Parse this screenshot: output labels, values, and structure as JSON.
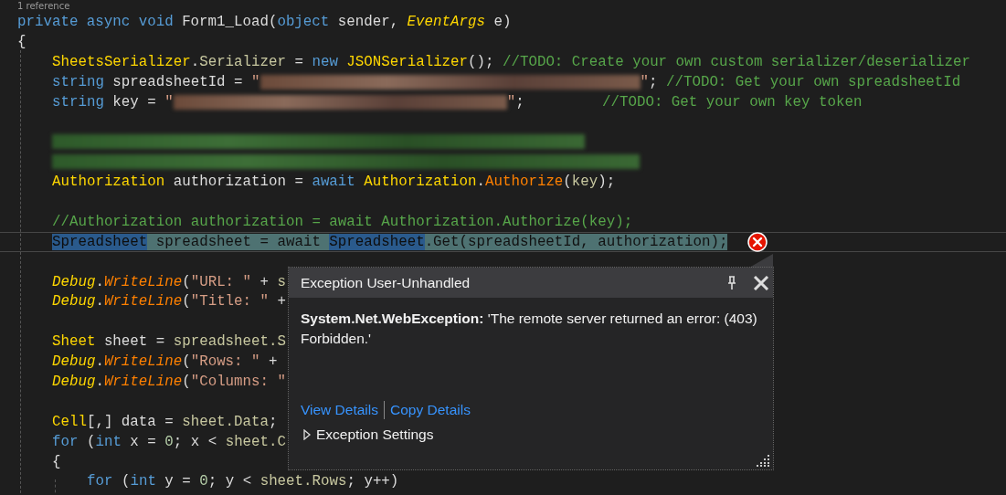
{
  "codelens": "1 reference",
  "lines": [
    {
      "kind": "code",
      "tokens": [
        {
          "kind": "keyword",
          "text": "private async void "
        },
        {
          "kind": "plain",
          "text": "Form1_Load("
        },
        {
          "kind": "keyword",
          "text": "object "
        },
        {
          "kind": "plain",
          "text": "sender, "
        },
        {
          "kind": "static-type",
          "text": "EventArgs"
        },
        {
          "kind": "plain",
          "text": " e)"
        }
      ]
    },
    {
      "kind": "code",
      "tokens": [
        {
          "kind": "plain",
          "text": "{"
        }
      ],
      "children": [
        {
          "kind": "code",
          "tokens": [
            {
              "kind": "type",
              "text": "SheetsSerializer"
            },
            {
              "kind": "plain",
              "text": "."
            },
            {
              "kind": "member",
              "text": "Serializer"
            },
            {
              "kind": "plain",
              "text": " = "
            },
            {
              "kind": "keyword",
              "text": "new "
            },
            {
              "kind": "type",
              "text": "JSONSerializer"
            },
            {
              "kind": "plain",
              "text": "(); "
            },
            {
              "kind": "comment",
              "text": "//TODO: Create your own custom serializer/deserializer"
            }
          ]
        },
        {
          "kind": "code",
          "tokens": [
            {
              "kind": "keyword",
              "text": "string "
            },
            {
              "kind": "plain",
              "text": "spreadsheetId = "
            },
            {
              "kind": "string",
              "text": "\""
            },
            {
              "kind": "redacted"
            },
            {
              "kind": "string",
              "text": "\""
            },
            {
              "kind": "plain",
              "text": "; "
            },
            {
              "kind": "comment",
              "text": "//TODO: Get your own spreadsheetId"
            }
          ]
        },
        {
          "kind": "code",
          "tokens": [
            {
              "kind": "keyword",
              "text": "string "
            },
            {
              "kind": "plain",
              "text": "key = "
            },
            {
              "kind": "string",
              "text": "\""
            },
            {
              "kind": "redacted"
            },
            {
              "kind": "string",
              "text": "\""
            },
            {
              "kind": "plain",
              "text": ";         "
            },
            {
              "kind": "comment",
              "text": "//TODO: Get your own key token"
            }
          ]
        },
        {
          "kind": "blank"
        },
        {
          "kind": "code",
          "tokens": [
            {
              "kind": "redacted-comment"
            }
          ]
        },
        {
          "kind": "code",
          "tokens": [
            {
              "kind": "redacted-comment"
            }
          ]
        },
        {
          "kind": "code",
          "tokens": [
            {
              "kind": "type",
              "text": "Authorization"
            },
            {
              "kind": "plain",
              "text": " authorization = "
            },
            {
              "kind": "keyword",
              "text": "await "
            },
            {
              "kind": "type",
              "text": "Authorization"
            },
            {
              "kind": "plain",
              "text": "."
            },
            {
              "kind": "method",
              "text": "Authorize"
            },
            {
              "kind": "plain",
              "text": "("
            },
            {
              "kind": "member",
              "text": "key"
            },
            {
              "kind": "plain",
              "text": ");"
            }
          ]
        },
        {
          "kind": "blank"
        },
        {
          "kind": "code",
          "tokens": [
            {
              "kind": "comment",
              "text": "//Authorization authorization = await Authorization.Authorize(key);"
            }
          ]
        },
        {
          "kind": "code",
          "highlighted": true,
          "tokens": [
            {
              "kind": "reference",
              "text": "Spreadsheet"
            },
            {
              "kind": "plain",
              "text": " spreadsheet = await "
            },
            {
              "kind": "reference",
              "text": "Spreadsheet"
            },
            {
              "kind": "plain",
              "text": ".Get(spreadsheetId, authorization);"
            }
          ]
        },
        {
          "kind": "blank"
        },
        {
          "kind": "code",
          "tokens": [
            {
              "kind": "static-type",
              "text": "Debug"
            },
            {
              "kind": "plain",
              "text": "."
            },
            {
              "kind": "static-method",
              "text": "WriteLine"
            },
            {
              "kind": "plain",
              "text": "("
            },
            {
              "kind": "string",
              "text": "\"URL: \""
            },
            {
              "kind": "plain",
              "text": " + "
            },
            {
              "kind": "member",
              "text": "s"
            }
          ]
        },
        {
          "kind": "code",
          "tokens": [
            {
              "kind": "static-type",
              "text": "Debug"
            },
            {
              "kind": "plain",
              "text": "."
            },
            {
              "kind": "static-method",
              "text": "WriteLine"
            },
            {
              "kind": "plain",
              "text": "("
            },
            {
              "kind": "string",
              "text": "\"Title: \""
            },
            {
              "kind": "plain",
              "text": " +"
            }
          ]
        },
        {
          "kind": "blank"
        },
        {
          "kind": "code",
          "tokens": [
            {
              "kind": "type",
              "text": "Sheet"
            },
            {
              "kind": "plain",
              "text": " sheet = "
            },
            {
              "kind": "member",
              "text": "spreadsheet.S"
            }
          ]
        },
        {
          "kind": "code",
          "tokens": [
            {
              "kind": "static-type",
              "text": "Debug"
            },
            {
              "kind": "plain",
              "text": "."
            },
            {
              "kind": "static-method",
              "text": "WriteLine"
            },
            {
              "kind": "plain",
              "text": "("
            },
            {
              "kind": "string",
              "text": "\"Rows: \""
            },
            {
              "kind": "plain",
              "text": " +"
            }
          ]
        },
        {
          "kind": "code",
          "tokens": [
            {
              "kind": "static-type",
              "text": "Debug"
            },
            {
              "kind": "plain",
              "text": "."
            },
            {
              "kind": "static-method",
              "text": "WriteLine"
            },
            {
              "kind": "plain",
              "text": "("
            },
            {
              "kind": "string",
              "text": "\"Columns: \""
            }
          ]
        },
        {
          "kind": "blank"
        },
        {
          "kind": "code",
          "tokens": [
            {
              "kind": "type",
              "text": "Cell"
            },
            {
              "kind": "plain",
              "text": "[,] data = "
            },
            {
              "kind": "member",
              "text": "sheet.Data"
            },
            {
              "kind": "plain",
              "text": ";"
            }
          ]
        },
        {
          "kind": "code",
          "tokens": [
            {
              "kind": "keyword",
              "text": "for"
            },
            {
              "kind": "plain",
              "text": " ("
            },
            {
              "kind": "keyword",
              "text": "int"
            },
            {
              "kind": "plain",
              "text": " x = "
            },
            {
              "kind": "number",
              "text": "0"
            },
            {
              "kind": "plain",
              "text": "; x < "
            },
            {
              "kind": "member",
              "text": "sheet.C"
            }
          ]
        },
        {
          "kind": "code",
          "tokens": [
            {
              "kind": "plain",
              "text": "{"
            }
          ],
          "children": [
            {
              "kind": "code",
              "tokens": [
                {
                  "kind": "keyword",
                  "text": "for"
                },
                {
                  "kind": "plain",
                  "text": " ("
                },
                {
                  "kind": "keyword",
                  "text": "int"
                },
                {
                  "kind": "plain",
                  "text": " y = "
                },
                {
                  "kind": "number",
                  "text": "0"
                },
                {
                  "kind": "plain",
                  "text": "; y < "
                },
                {
                  "kind": "member",
                  "text": "sheet.Rows"
                },
                {
                  "kind": "plain",
                  "text": "; y++)"
                }
              ]
            }
          ]
        }
      ]
    }
  ],
  "exception": {
    "title": "Exception User-Unhandled",
    "message": "**System.Net.WebException:** 'The remote server returned an error: (403) Forbidden.'",
    "links": [
      "View Details",
      "Copy Details"
    ],
    "settings": {
      "label": "Exception Settings",
      "expanded": false
    }
  }
}
